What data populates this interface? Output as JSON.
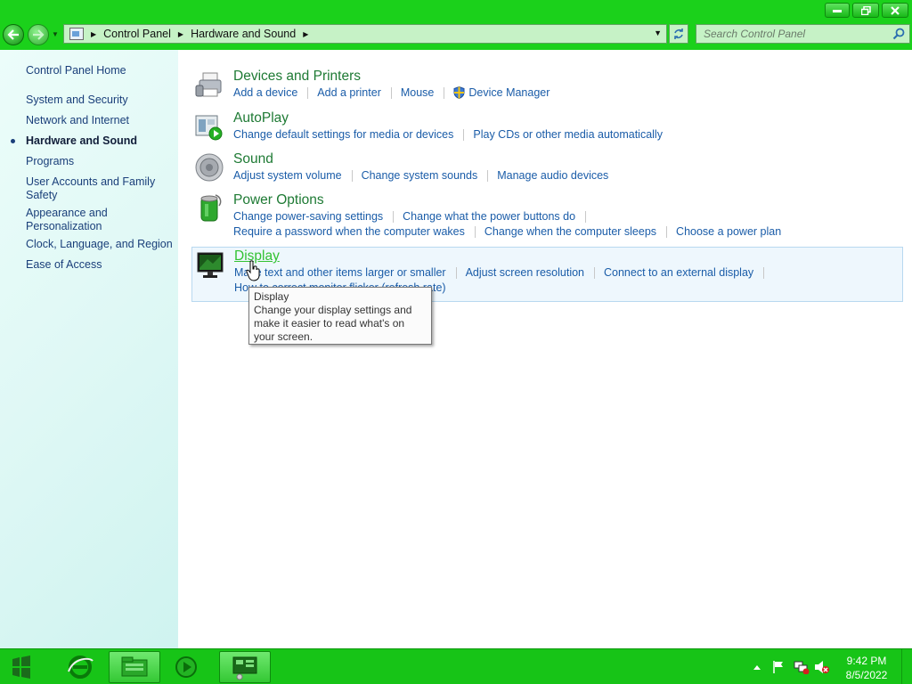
{
  "window": {
    "minimize_icon": "minimize-icon",
    "maximize_icon": "restore-icon",
    "close_icon": "close-icon"
  },
  "address": {
    "crumbs": [
      "Control Panel",
      "Hardware and Sound"
    ],
    "search_placeholder": "Search Control Panel"
  },
  "sidebar": {
    "items": [
      {
        "label": "Control Panel Home"
      },
      {
        "label": "System and Security"
      },
      {
        "label": "Network and Internet"
      },
      {
        "label": "Hardware and Sound",
        "active": true
      },
      {
        "label": "Programs"
      },
      {
        "label": "User Accounts and Family Safety"
      },
      {
        "label": "Appearance and Personalization"
      },
      {
        "label": "Clock, Language, and Region"
      },
      {
        "label": "Ease of Access"
      }
    ]
  },
  "categories": [
    {
      "title": "Devices and Printers",
      "icon": "printer-icon",
      "links": [
        "Add a device",
        "Add a printer",
        "Mouse",
        "Device Manager"
      ]
    },
    {
      "title": "AutoPlay",
      "icon": "autoplay-icon",
      "links": [
        "Change default settings for media or devices",
        "Play CDs or other media automatically"
      ]
    },
    {
      "title": "Sound",
      "icon": "speaker-icon",
      "links": [
        "Adjust system volume",
        "Change system sounds",
        "Manage audio devices"
      ]
    },
    {
      "title": "Power Options",
      "icon": "battery-icon",
      "links": [
        "Change power-saving settings",
        "Change what the power buttons do"
      ],
      "links2": [
        "Require a password when the computer wakes",
        "Change when the computer sleeps",
        "Choose a power plan"
      ]
    },
    {
      "title": "Display",
      "icon": "monitor-icon",
      "links": [
        "Make text and other items larger or smaller",
        "Adjust screen resolution",
        "Connect to an external display"
      ],
      "links2": [
        "How to correct monitor flicker (refresh rate)"
      ]
    }
  ],
  "tooltip": {
    "title": "Display",
    "body": "Change your display settings and make it easier to read what's on your screen."
  },
  "taskbar": {
    "time": "9:42 PM",
    "date": "8/5/2022"
  },
  "colors": {
    "chrome": "#1bd11b",
    "link": "#1a5ca8",
    "category_title": "#1e7a34"
  }
}
